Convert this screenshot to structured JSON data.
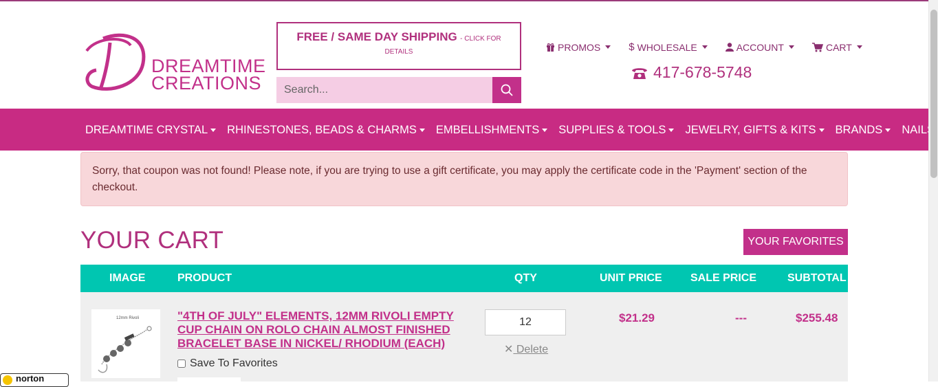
{
  "brand": {
    "line1": "DREAMTIME",
    "line2": "CREATIONS",
    "color": "#c2308a"
  },
  "shipping": {
    "main": "FREE / SAME DAY SHIPPING",
    "small": "- CLICK FOR",
    "small2": "DETAILS"
  },
  "search": {
    "placeholder": "Search...",
    "icon": "search-icon"
  },
  "topnav": [
    {
      "label": "PROMOS",
      "icon": "gift-icon"
    },
    {
      "label": "WHOLESALE",
      "icon": "dollar-icon"
    },
    {
      "label": "ACCOUNT",
      "icon": "user-icon"
    },
    {
      "label": "CART",
      "icon": "cart-icon"
    }
  ],
  "phone": {
    "number": "417-678-5748",
    "icon": "phone-icon"
  },
  "mainnav": [
    "DREAMTIME CRYSTAL",
    "RHINESTONES, BEADS & CHARMS",
    "EMBELLISHMENTS",
    "SUPPLIES & TOOLS",
    "JEWELRY, GIFTS & KITS",
    "BRANDS",
    "NAILS"
  ],
  "alert": {
    "text": "Sorry, that coupon was not found! Please note, if you are trying to use a gift certificate, you may apply the certificate code in the 'Payment' section of the checkout."
  },
  "cart": {
    "title": "YOUR CART",
    "favorites_button": "YOUR FAVORITES",
    "columns": [
      "IMAGE",
      "PRODUCT",
      "QTY",
      "UNIT PRICE",
      "SALE PRICE",
      "SUBTOTAL"
    ],
    "items": [
      {
        "image_caption": "12mm Rivoli",
        "product": "\"4TH OF JULY\" ELEMENTS, 12MM RIVOLI EMPTY CUP CHAIN ON ROLO CHAIN ALMOST FINISHED BRACELET BASE IN NICKEL/ RHODIUM (EACH)",
        "save_label": "Save To Favorites",
        "qty": "12",
        "delete_label": "Delete",
        "unit_price": "$21.29",
        "sale_price": "---",
        "subtotal": "$255.48"
      }
    ]
  },
  "badge": {
    "label": "norton"
  },
  "colors": {
    "accent": "#c82b83",
    "teal": "#00c6b1",
    "alert_bg": "#f8d7da"
  }
}
